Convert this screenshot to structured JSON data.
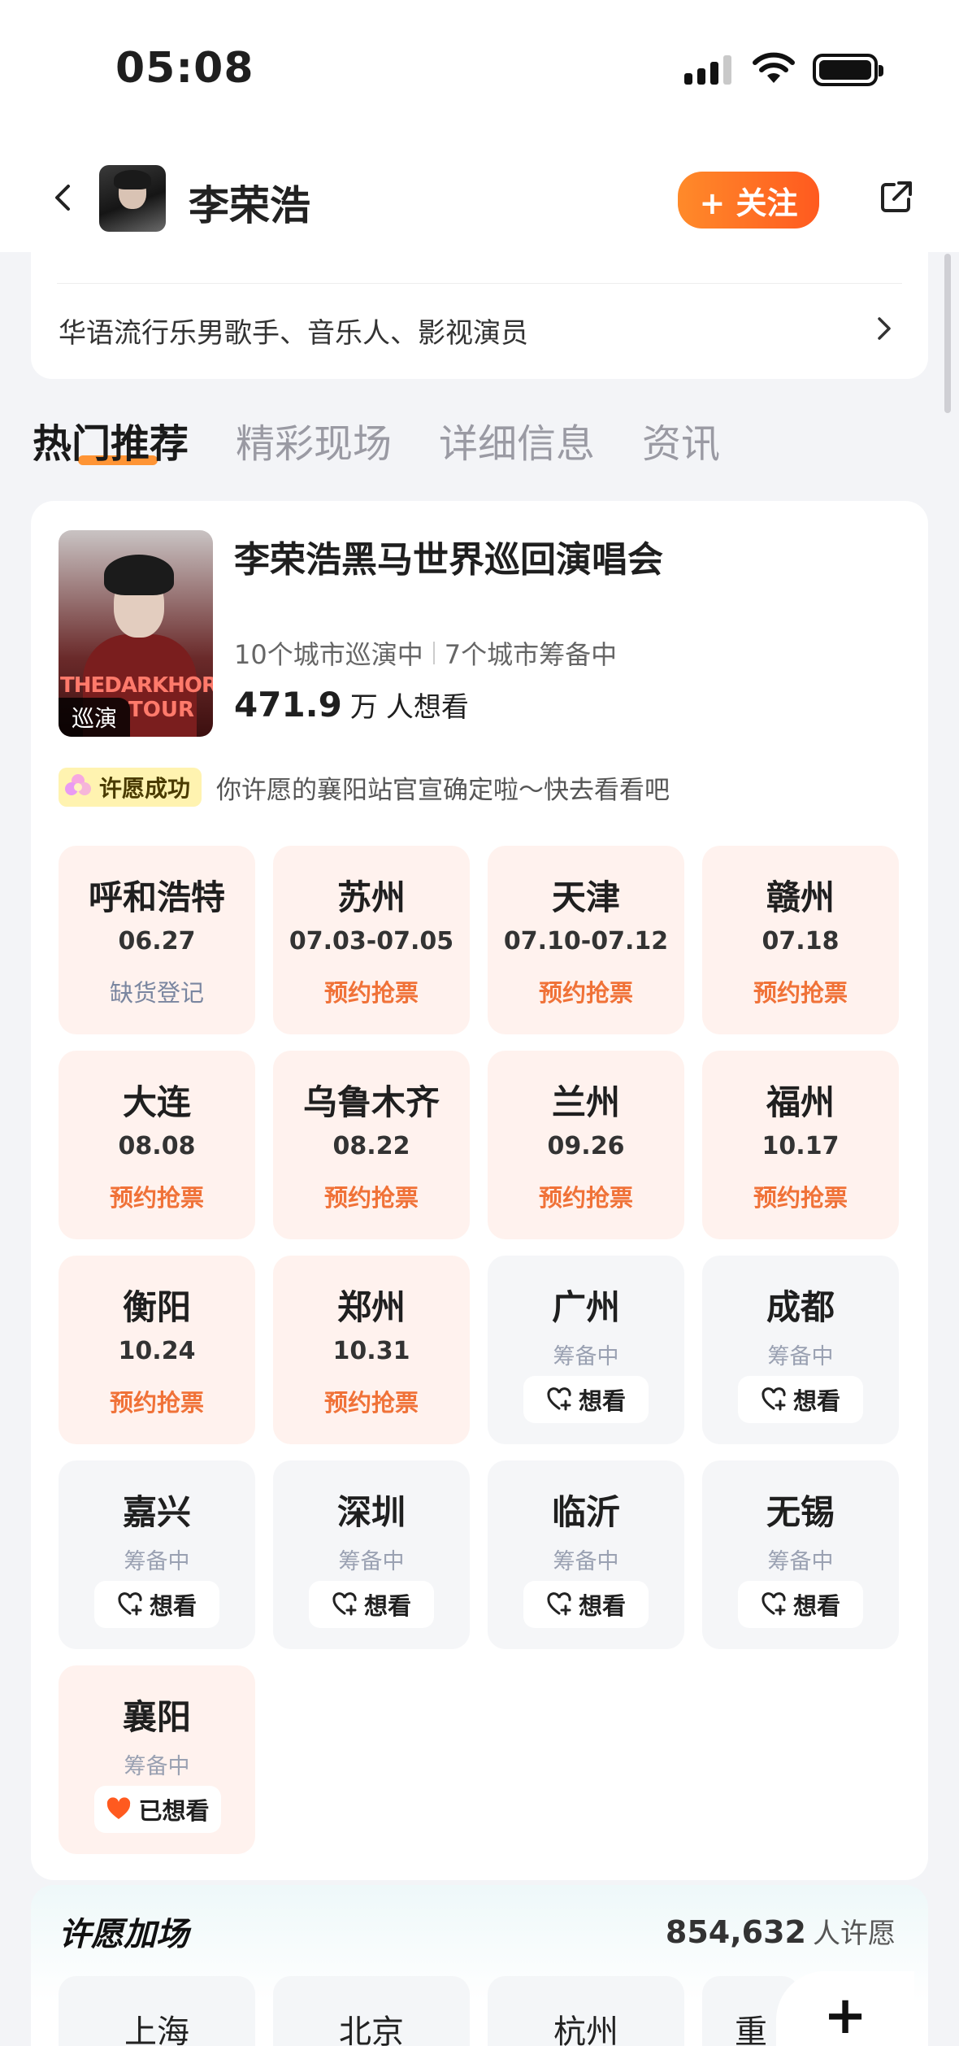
{
  "status_bar": {
    "time": "05:08"
  },
  "header": {
    "artist_name": "李荣浩",
    "follow_label": "+ 关注"
  },
  "description": {
    "text": "华语流行乐男歌手、音乐人、影视演员"
  },
  "tabs": [
    {
      "label": "热门推荐",
      "active": true
    },
    {
      "label": "精彩现场",
      "active": false
    },
    {
      "label": "详细信息",
      "active": false
    },
    {
      "label": "资讯",
      "active": false
    }
  ],
  "tour": {
    "title": "李荣浩黑马世界巡回演唱会",
    "badge": "巡演",
    "poster_text_1": "THEDARKHORSE",
    "poster_text_2": "TOUR",
    "cities_touring": "10个城市巡演中",
    "cities_planning": "7个城市筹备中",
    "wish_number": "471.9",
    "wish_unit": "万",
    "wish_suffix": "人想看",
    "note_badge": "许愿成功",
    "note_text": "你许愿的襄阳站官宣确定啦～快去看看吧"
  },
  "cities": [
    {
      "name": "呼和浩特",
      "date": "06.27",
      "status": "缺货登记",
      "type": "gray"
    },
    {
      "name": "苏州",
      "date": "07.03-07.05",
      "status": "预约抢票",
      "type": "sale"
    },
    {
      "name": "天津",
      "date": "07.10-07.12",
      "status": "预约抢票",
      "type": "sale"
    },
    {
      "name": "赣州",
      "date": "07.18",
      "status": "预约抢票",
      "type": "sale"
    },
    {
      "name": "大连",
      "date": "08.08",
      "status": "预约抢票",
      "type": "sale"
    },
    {
      "name": "乌鲁木齐",
      "date": "08.22",
      "status": "预约抢票",
      "type": "sale"
    },
    {
      "name": "兰州",
      "date": "09.26",
      "status": "预约抢票",
      "type": "sale"
    },
    {
      "name": "福州",
      "date": "10.17",
      "status": "预约抢票",
      "type": "sale"
    },
    {
      "name": "衡阳",
      "date": "10.24",
      "status": "预约抢票",
      "type": "sale"
    },
    {
      "name": "郑州",
      "date": "10.31",
      "status": "预约抢票",
      "type": "sale"
    },
    {
      "name": "广州",
      "sub": "筹备中",
      "button": "想看",
      "type": "planning"
    },
    {
      "name": "成都",
      "sub": "筹备中",
      "button": "想看",
      "type": "planning"
    },
    {
      "name": "嘉兴",
      "sub": "筹备中",
      "button": "想看",
      "type": "planning"
    },
    {
      "name": "深圳",
      "sub": "筹备中",
      "button": "想看",
      "type": "planning"
    },
    {
      "name": "临沂",
      "sub": "筹备中",
      "button": "想看",
      "type": "planning"
    },
    {
      "name": "无锡",
      "sub": "筹备中",
      "button": "想看",
      "type": "planning"
    },
    {
      "name": "襄阳",
      "sub": "筹备中",
      "button": "已想看",
      "type": "wished"
    }
  ],
  "wish_section": {
    "title": "许愿加场",
    "count": "854,632",
    "count_suffix": "人许愿",
    "cities": [
      "上海",
      "北京",
      "杭州",
      "重"
    ]
  },
  "colors": {
    "accent_orange": "#ff6a24",
    "sale_status": "#f07238",
    "sale_cell_bg": "#fff2ee",
    "planning_cell_bg": "#f5f6f8",
    "wished_heart": "#ff5a1f"
  },
  "icons": {
    "back": "chevron-left-icon",
    "share": "share-icon",
    "chevron": "chevron-right-icon",
    "want": "heart-plus-icon",
    "wanted": "heart-filled-icon",
    "plus": "plus-icon"
  }
}
